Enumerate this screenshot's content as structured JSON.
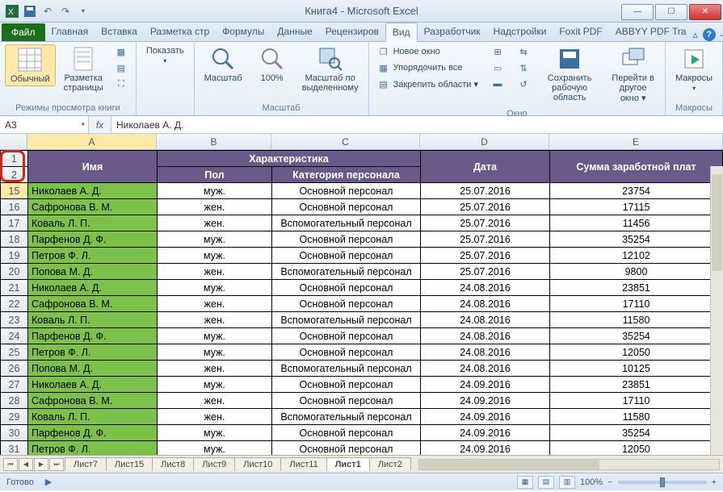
{
  "title": "Книга4  -  Microsoft Excel",
  "qat": {
    "save": "save-icon",
    "undo": "undo-icon",
    "redo": "redo-icon"
  },
  "tabs": {
    "file": "Файл",
    "items": [
      "Главная",
      "Вставка",
      "Разметка стр",
      "Формулы",
      "Данные",
      "Рецензиров",
      "Вид",
      "Разработчик",
      "Надстройки",
      "Foxit PDF",
      "ABBYY PDF Tra"
    ],
    "active_index": 6
  },
  "ribbon": {
    "g1_label": "Режимы просмотра книги",
    "g1_normal": "Обычный",
    "g1_layout": "Разметка\nстраницы",
    "g2_show": "Показать",
    "g3_label": "Масштаб",
    "g3_zoom": "Масштаб",
    "g3_100": "100%",
    "g3_fit": "Масштаб по\nвыделенному",
    "g4_label": "Окно",
    "g4_newwin": "Новое окно",
    "g4_arrange": "Упорядочить все",
    "g4_freeze": "Закрепить области ▾",
    "g4_save_area": "Сохранить\nрабочую область",
    "g4_switch": "Перейти в\nдругое окно ▾",
    "g5_label": "Макросы",
    "g5_macros": "Макросы"
  },
  "namebox": "A3",
  "fx_label": "fx",
  "formula": "Николаев А. Д.",
  "columns": [
    "A",
    "B",
    "C",
    "D",
    "E"
  ],
  "row_headers_top": [
    "1",
    "2"
  ],
  "table_headers": {
    "merged_top_bc": "Характеристика",
    "a": "Имя",
    "b": "Пол",
    "c": "Категория персонала",
    "d": "Дата",
    "e": "Сумма заработной плат"
  },
  "rows": [
    {
      "n": "15",
      "a": "Николаев А. Д.",
      "b": "муж.",
      "c": "Основной персонал",
      "d": "25.07.2016",
      "e": "23754"
    },
    {
      "n": "16",
      "a": "Сафронова В. М.",
      "b": "жен.",
      "c": "Основной персонал",
      "d": "25.07.2016",
      "e": "17115"
    },
    {
      "n": "17",
      "a": "Коваль Л. П.",
      "b": "жен.",
      "c": "Вспомогательный персонал",
      "d": "25.07.2016",
      "e": "11456"
    },
    {
      "n": "18",
      "a": "Парфенов Д. Ф.",
      "b": "муж.",
      "c": "Основной персонал",
      "d": "25.07.2016",
      "e": "35254"
    },
    {
      "n": "19",
      "a": "Петров Ф. Л.",
      "b": "муж.",
      "c": "Основной персонал",
      "d": "25.07.2016",
      "e": "12102"
    },
    {
      "n": "20",
      "a": "Попова М. Д.",
      "b": "жен.",
      "c": "Вспомогательный персонал",
      "d": "25.07.2016",
      "e": "9800"
    },
    {
      "n": "21",
      "a": "Николаев А. Д.",
      "b": "муж.",
      "c": "Основной персонал",
      "d": "24.08.2016",
      "e": "23851"
    },
    {
      "n": "22",
      "a": "Сафронова В. М.",
      "b": "жен.",
      "c": "Основной персонал",
      "d": "24.08.2016",
      "e": "17110"
    },
    {
      "n": "23",
      "a": "Коваль Л. П.",
      "b": "жен.",
      "c": "Вспомогательный персонал",
      "d": "24.08.2016",
      "e": "11580"
    },
    {
      "n": "24",
      "a": "Парфенов Д. Ф.",
      "b": "муж.",
      "c": "Основной персонал",
      "d": "24.08.2016",
      "e": "35254"
    },
    {
      "n": "25",
      "a": "Петров Ф. Л.",
      "b": "муж.",
      "c": "Основной персонал",
      "d": "24.08.2016",
      "e": "12050"
    },
    {
      "n": "26",
      "a": "Попова М. Д.",
      "b": "жен.",
      "c": "Вспомогательный персонал",
      "d": "24.08.2016",
      "e": "10125"
    },
    {
      "n": "27",
      "a": "Николаев А. Д.",
      "b": "муж.",
      "c": "Основной персонал",
      "d": "24.09.2016",
      "e": "23851"
    },
    {
      "n": "28",
      "a": "Сафронова В. М.",
      "b": "жен.",
      "c": "Основной персонал",
      "d": "24.09.2016",
      "e": "17110"
    },
    {
      "n": "29",
      "a": "Коваль Л. П.",
      "b": "жен.",
      "c": "Вспомогательный персонал",
      "d": "24.09.2016",
      "e": "11580"
    },
    {
      "n": "30",
      "a": "Парфенов Д. Ф.",
      "b": "муж.",
      "c": "Основной персонал",
      "d": "24.09.2016",
      "e": "35254"
    },
    {
      "n": "31",
      "a": "Петров Ф. Л.",
      "b": "муж.",
      "c": "Основной персонал",
      "d": "24.09.2016",
      "e": "12050"
    }
  ],
  "sheet_tabs": [
    "Лист7",
    "Лист15",
    "Лист8",
    "Лист9",
    "Лист10",
    "Лист11",
    "Лист1",
    "Лист2"
  ],
  "sheet_active_index": 6,
  "status": {
    "ready": "Готово",
    "zoom": "100%",
    "minus": "−",
    "plus": "+"
  }
}
